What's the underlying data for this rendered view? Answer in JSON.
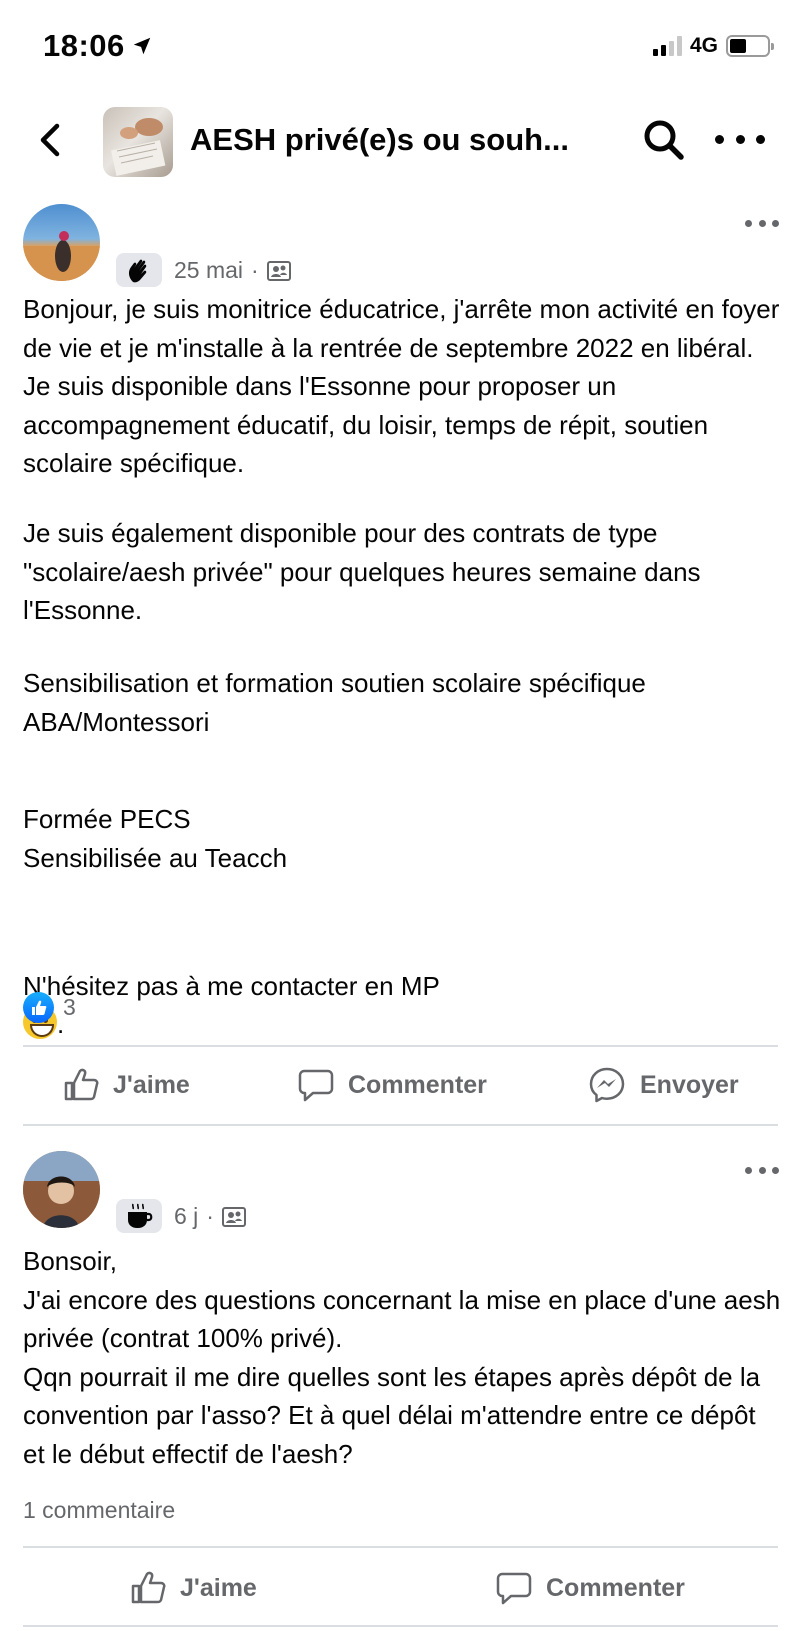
{
  "status_bar": {
    "time": "18:06",
    "network": "4G"
  },
  "header": {
    "group_title": "AESH privé(e)s ou souh..."
  },
  "posts": [
    {
      "date": "25 mai",
      "separator": "·",
      "paragraphs": [
        "Bonjour, je suis monitrice éducatrice, j'arrête mon activité en foyer de vie et je m'installe à la rentrée de septembre 2022 en libéral. Je suis disponible dans l'Essonne pour proposer un accompagnement éducatif, du loisir, temps de répit, soutien scolaire spécifique.",
        "Je suis également disponible pour des contrats de type \"scolaire/aesh privée\" pour quelques heures semaine dans l'Essonne.",
        "Sensibilisation et formation soutien scolaire spécifique\nABA/Montessori",
        "Formée PECS\nSensibilisée au Teacch"
      ],
      "closing_text": "N'hésitez pas à me contacter en MP",
      "closing_suffix": ".",
      "reaction_count": "3",
      "actions": {
        "like": "J'aime",
        "comment": "Commenter",
        "send": "Envoyer"
      }
    },
    {
      "date": "6 j",
      "separator": "·",
      "text": "Bonsoir,\nJ'ai encore des questions concernant la mise en place d'une aesh privée (contrat 100% privé).\nQqn pourrait il me dire quelles sont les étapes après dépôt de la convention par l'asso? Et à quel délai m'attendre entre ce dépôt et le début effectif de l'aesh?",
      "comment_count": "1 commentaire",
      "actions": {
        "like": "J'aime",
        "comment": "Commenter"
      }
    }
  ]
}
